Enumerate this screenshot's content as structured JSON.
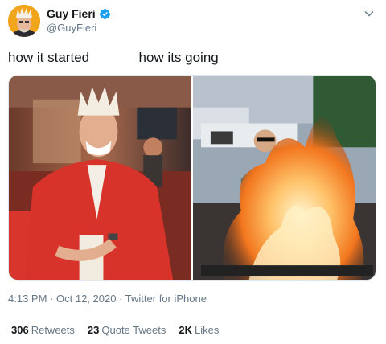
{
  "user": {
    "display_name": "Guy Fieri",
    "handle": "@GuyFieri",
    "verified": true,
    "avatar_icon": "avatar-photo"
  },
  "tweet": {
    "text": "how it started             how its going"
  },
  "media": {
    "left_alt": "man in red shirt laughing in diner",
    "right_alt": "man in sunglasses behind large fire"
  },
  "meta": {
    "time": "4:13 PM",
    "date": "Oct 12, 2020",
    "source": "Twitter for iPhone",
    "sep": "·"
  },
  "stats": {
    "retweets_count": "306",
    "retweets_label": "Retweets",
    "quotes_count": "23",
    "quotes_label": "Quote Tweets",
    "likes_count": "2K",
    "likes_label": "Likes"
  },
  "colors": {
    "verified_blue": "#1da1f2",
    "secondary_text": "#657786",
    "primary_text": "#14171a"
  }
}
